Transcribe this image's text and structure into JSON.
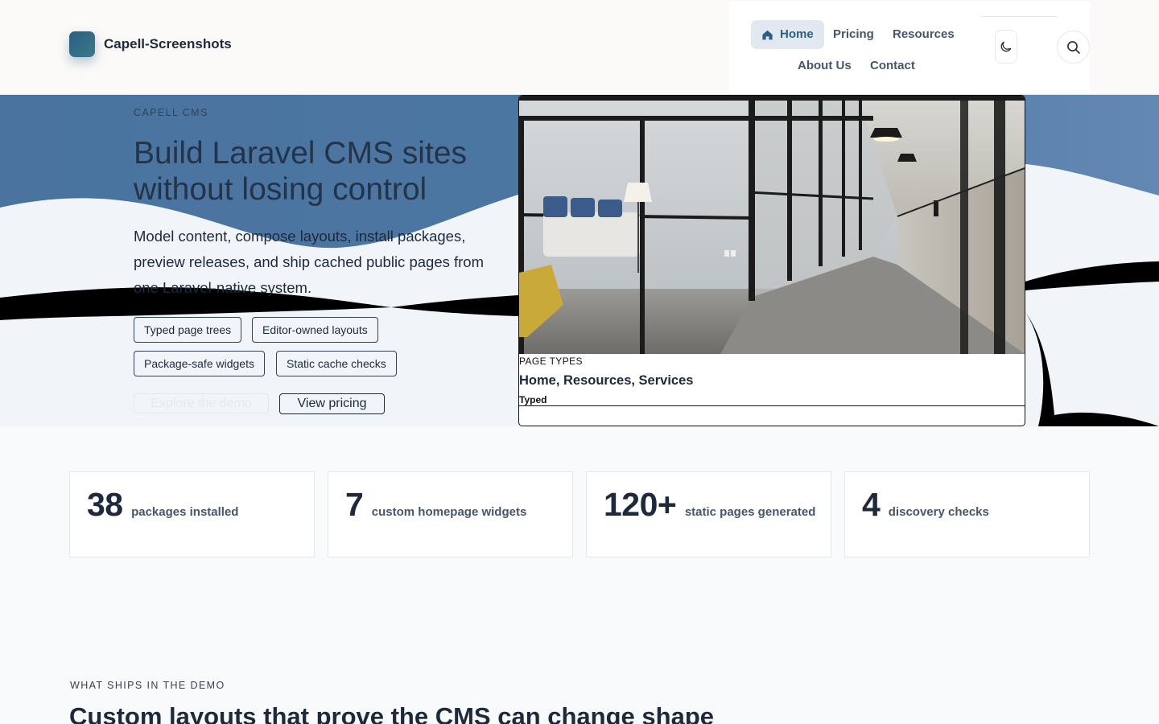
{
  "header": {
    "brand_name": "Capell-Screenshots",
    "nav": [
      {
        "label": "Home",
        "icon": "home-icon",
        "active": true
      },
      {
        "label": "Pricing"
      },
      {
        "label": "Resources"
      },
      {
        "label": "About Us"
      },
      {
        "label": "Contact"
      }
    ],
    "theme_toggle_icon": "moon-icon",
    "search_icon": "search-icon"
  },
  "hero": {
    "eyebrow": "CAPELL CMS",
    "title": "Build Laravel CMS sites without losing control",
    "description": "Model content, compose layouts, install packages, preview releases, and ship cached public pages from one Laravel-native system.",
    "tags": [
      "Typed page trees",
      "Editor-owned layouts",
      "Package-safe widgets",
      "Static cache checks"
    ],
    "cta_primary": "Explore the demo",
    "cta_secondary": "View pricing",
    "card": {
      "eyebrow": "PAGE TYPES",
      "title": "Home, Resources, Services",
      "subtitle": "Typed"
    }
  },
  "stats": [
    {
      "value": "38",
      "label": "packages installed"
    },
    {
      "value": "7",
      "label": "custom homepage widgets"
    },
    {
      "value": "120+",
      "label": "static pages generated"
    },
    {
      "value": "4",
      "label": "discovery checks"
    }
  ],
  "section": {
    "eyebrow": "WHAT SHIPS IN THE DEMO",
    "title": "Custom layouts that prove the CMS can change shape"
  },
  "colors": {
    "brand": "#2d5e82",
    "hero_blue": "#4f7aa6",
    "text": "#1e293b"
  }
}
